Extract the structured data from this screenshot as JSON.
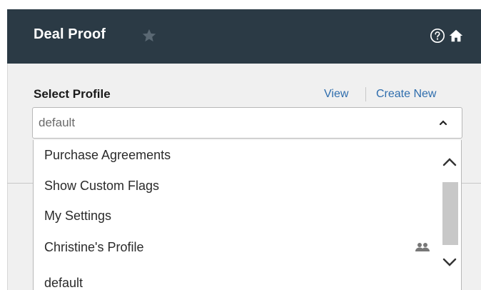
{
  "header": {
    "title": "Deal Proof",
    "star_icon": "star-icon",
    "help_icon": "help-circle-icon",
    "home_icon": "home-icon",
    "bg_color": "#2b3a45"
  },
  "profile": {
    "label": "Select Profile",
    "view_link": "View",
    "create_link": "Create New",
    "selected_value": "default",
    "link_color": "#2e6dad"
  },
  "dropdown": {
    "options": [
      {
        "label": "Purchase Agreements"
      },
      {
        "label": "Show Custom Flags"
      },
      {
        "label": "My Settings"
      },
      {
        "label": "Christine's Profile",
        "shared": true
      },
      {
        "label": "default"
      }
    ],
    "shared_icon": "shared-users-icon"
  }
}
